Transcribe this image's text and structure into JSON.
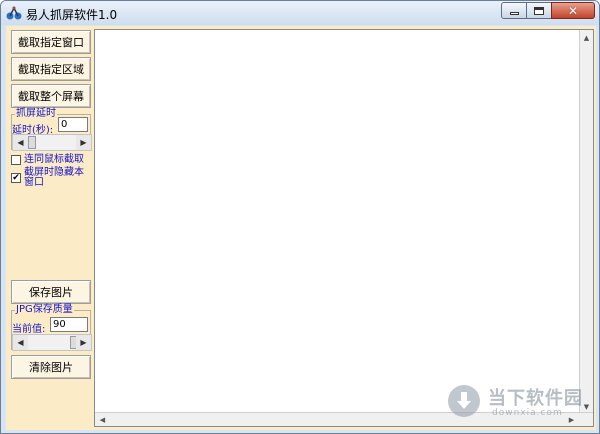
{
  "window": {
    "title": "易人抓屏软件1.0",
    "controls": {
      "close_symbol": "✕"
    }
  },
  "toolbar": {
    "capture_window": "截取指定窗口",
    "capture_region": "截取指定区域",
    "capture_fullscreen": "截取整个屏幕",
    "save_image": "保存图片",
    "clear_image": "清除图片"
  },
  "delay_group": {
    "title": "抓屏延时",
    "label": "延时(秒):",
    "value": "0"
  },
  "options": {
    "with_cursor": {
      "label": "连同鼠标截取",
      "checked": false
    },
    "hide_window": {
      "label": "截屏时隐藏本窗口",
      "checked": true,
      "check_glyph": "✔"
    }
  },
  "quality_group": {
    "title": "JPG保存质量",
    "label": "当前值:",
    "value": "90"
  },
  "watermark": {
    "brand": "当下软件园",
    "domain": "downxia.com"
  },
  "colors": {
    "panel_bg": "#fcebc7",
    "label_blue": "#1515c8",
    "close_red": "#c2432a"
  }
}
